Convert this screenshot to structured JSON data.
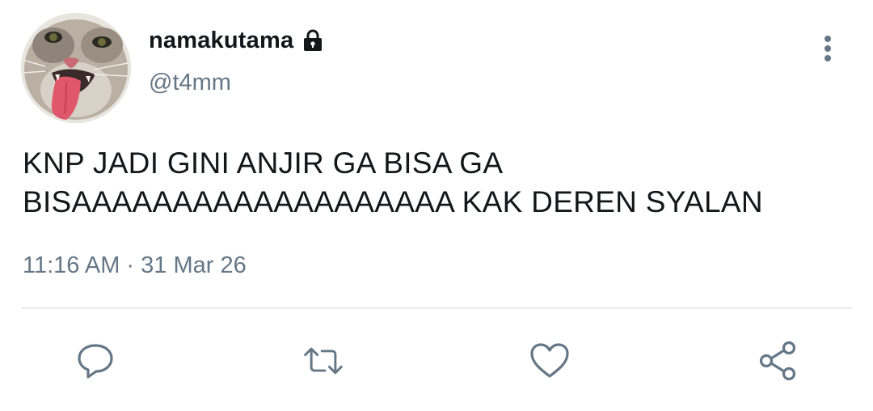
{
  "tweet": {
    "display_name": "namakutama",
    "handle": "@t4mm",
    "protected_icon": "lock-icon",
    "avatar": "cat-photo",
    "text": "KNP JADI GINI ANJIR GA BISA GA\nBISAAAAAAAAAAAAAAAAAAA KAK DEREN SYALAN",
    "timestamp": "11:16 AM · 31 Mar 26",
    "more_icon": "more-vertical-icon"
  },
  "actions": [
    {
      "name": "reply",
      "icon": "comment-icon"
    },
    {
      "name": "retweet",
      "icon": "retweet-icon"
    },
    {
      "name": "like",
      "icon": "heart-icon"
    },
    {
      "name": "share",
      "icon": "share-icon"
    }
  ],
  "colors": {
    "text_primary": "#14171a",
    "text_secondary": "#657786",
    "icon": "#657786",
    "divider": "#e6ecf0",
    "background": "#ffffff"
  }
}
